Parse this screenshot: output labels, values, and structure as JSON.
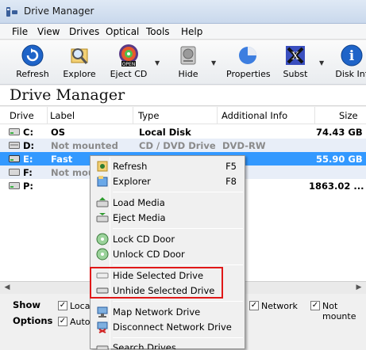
{
  "window": {
    "title": "Drive Manager"
  },
  "menu": [
    "File",
    "View",
    "Drives",
    "Optical",
    "Tools",
    "Help"
  ],
  "toolbar": {
    "buttons": [
      {
        "label": "Refresh",
        "icon": "refresh-icon"
      },
      {
        "label": "Explore",
        "icon": "explore-icon"
      },
      {
        "label": "Eject CD",
        "icon": "eject-cd-icon",
        "badge": "OPEN"
      },
      {
        "label": "Hide",
        "icon": "hide-drive-icon"
      },
      {
        "label": "Properties",
        "icon": "properties-icon"
      },
      {
        "label": "Subst",
        "icon": "subst-icon"
      },
      {
        "label": "Disk Inf",
        "icon": "info-icon",
        "glyph": "i"
      }
    ]
  },
  "header": {
    "title": "Drive Manager"
  },
  "columns": [
    "Drive",
    "Label",
    "Type",
    "Additional Info",
    "Size"
  ],
  "rows": [
    {
      "drive": "C:",
      "label": "OS",
      "type": "Local Disk",
      "info": "",
      "size": "74.43 GB",
      "state": "normal"
    },
    {
      "drive": "D:",
      "label": "Not mounted",
      "type": "CD / DVD Drive",
      "info": "DVD-RW",
      "size": "",
      "state": "grey"
    },
    {
      "drive": "E:",
      "label": "Fast",
      "type": "",
      "info": "",
      "size": "55.90 GB",
      "state": "selected"
    },
    {
      "drive": "F:",
      "label": "Not mou",
      "type": "",
      "info": "",
      "size": "",
      "state": "grey"
    },
    {
      "drive": "P:",
      "label": "",
      "type": "",
      "info": "",
      "size": "1863.02 ...",
      "state": "normal"
    }
  ],
  "options": {
    "show_label": "Show",
    "options_label": "Options",
    "checks": [
      {
        "label": "Local",
        "checked": true
      },
      {
        "label": "Auto",
        "checked": true
      },
      {
        "label": "Network",
        "checked": true
      },
      {
        "label": "Not mounte",
        "checked": true
      }
    ]
  },
  "context_menu": {
    "items": [
      {
        "label": "Refresh",
        "shortcut": "F5",
        "icon": "refresh-small-icon"
      },
      {
        "label": "Explorer",
        "shortcut": "F8",
        "icon": "explorer-small-icon"
      },
      {
        "label": "Load Media",
        "shortcut": "",
        "icon": "load-media-icon"
      },
      {
        "label": "Eject Media",
        "shortcut": "",
        "icon": "eject-media-icon"
      },
      {
        "label": "Lock CD Door",
        "shortcut": "",
        "icon": "lock-cd-icon"
      },
      {
        "label": "Unlock CD Door",
        "shortcut": "",
        "icon": "unlock-cd-icon"
      },
      {
        "label": "Hide Selected Drive",
        "shortcut": "",
        "icon": "hide-selected-icon"
      },
      {
        "label": "Unhide Selected Drive",
        "shortcut": "",
        "icon": "unhide-selected-icon"
      },
      {
        "label": "Map Network Drive",
        "shortcut": "",
        "icon": "map-network-icon"
      },
      {
        "label": "Disconnect Network Drive",
        "shortcut": "",
        "icon": "disconnect-network-icon"
      },
      {
        "label": "Search Drives",
        "shortcut": "",
        "icon": "search-drives-icon"
      }
    ]
  },
  "colors": {
    "selection": "#3399ff",
    "alt_row": "#e8eef8",
    "highlight_box": "#e01818"
  }
}
